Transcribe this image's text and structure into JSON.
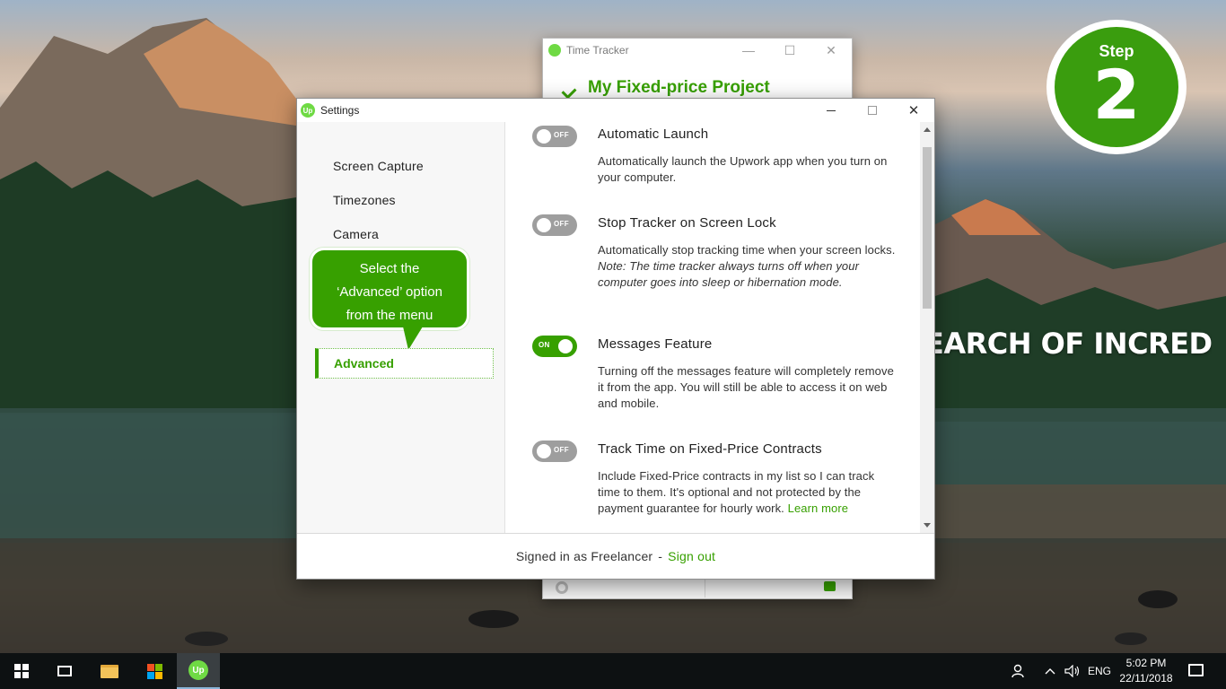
{
  "wallpaper": {
    "text": "EARCH OF INCREDIBLE"
  },
  "step_badge": {
    "label": "Step",
    "number": "2"
  },
  "time_tracker": {
    "window_title": "Time Tracker",
    "project_name": "My Fixed-price Project"
  },
  "settings_window": {
    "title": "Settings",
    "app_icon_text": "Up",
    "sidebar": {
      "items": [
        {
          "label": "Screen Capture"
        },
        {
          "label": "Timezones"
        },
        {
          "label": "Camera"
        }
      ],
      "active_item": "Advanced"
    },
    "tooltip": {
      "line1": "Select the",
      "line2": "‘Advanced’ option",
      "line3": "from the menu"
    },
    "settings": [
      {
        "title": "Automatic Launch",
        "state": "OFF",
        "description": "Automatically launch the Upwork app when you turn on your computer."
      },
      {
        "title": "Stop Tracker on Screen Lock",
        "state": "OFF",
        "description": "Automatically stop tracking time when your screen locks.",
        "note": "Note: The time tracker always turns off when your computer goes into sleep or hibernation mode."
      },
      {
        "title": "Messages Feature",
        "state": "ON",
        "description": "Turning off the messages feature will completely remove it from the app. You will still be able to access it on web and mobile."
      },
      {
        "title": "Track Time on Fixed-Price Contracts",
        "state": "OFF",
        "description": "Include Fixed-Price contracts in my list so I can track time to them. It's optional and not protected by the payment guarantee for hourly work.",
        "link": "Learn more"
      }
    ],
    "footer": {
      "signed_in_text": "Signed in as Freelancer",
      "separator": "-",
      "sign_out_label": "Sign out"
    }
  },
  "taskbar": {
    "app_icon_text": "Up",
    "language": "ENG",
    "time": "5:02 PM",
    "date": "22/11/2018"
  },
  "colors": {
    "upwork_green": "#37a000",
    "toggle_off": "#9e9e9e",
    "taskbar": "#0d1112"
  }
}
